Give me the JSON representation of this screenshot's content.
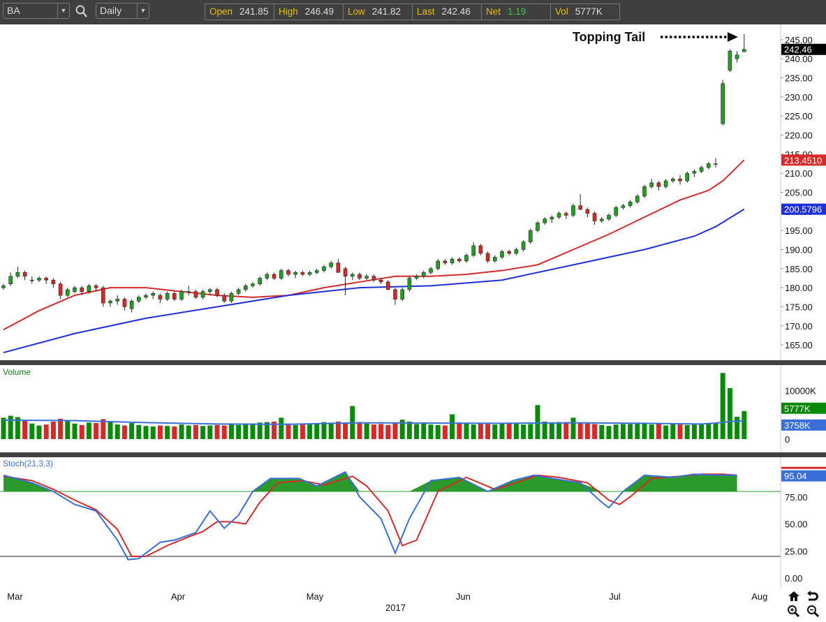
{
  "toolbar": {
    "symbol": "BA",
    "period": "Daily",
    "quote": [
      {
        "label": "Open",
        "value": "241.85"
      },
      {
        "label": "High",
        "value": "246.49"
      },
      {
        "label": "Low",
        "value": "241.82"
      },
      {
        "label": "Last",
        "value": "242.46"
      },
      {
        "label": "Net",
        "value": "1.19"
      },
      {
        "label": "Vol",
        "value": "5777K"
      }
    ]
  },
  "annotation": "Topping Tail",
  "price_tags": {
    "last": "242.46",
    "ma_fast": "213.4510",
    "ma_slow": "200.5796"
  },
  "volume": {
    "title": "Volume",
    "tag_vol": "5777K",
    "tag_ma": "3758K",
    "tick_10000": "10000K",
    "tick_0": "0"
  },
  "stoch": {
    "title": "Stoch(21,3,3)",
    "tag": "95.04"
  },
  "colors": {
    "up": "#22a022",
    "down": "#d42a2a",
    "ma_fast": "#d42a2a",
    "ma_slow": "#1f2fd8",
    "vol_ma": "#3a6fd8",
    "stoch_k": "#3a6fd8",
    "stoch_d": "#d42a2a",
    "fill": "#2a9a2a"
  },
  "chart_data": {
    "type": "candlestick",
    "title": "BA Daily",
    "ylim": [
      161,
      249
    ],
    "yticks": [
      "165.00",
      "170.00",
      "175.00",
      "180.00",
      "185.00",
      "190.00",
      "195.00",
      "200.00",
      "205.00",
      "210.00",
      "215.00",
      "220.00",
      "225.00",
      "230.00",
      "235.00",
      "240.00",
      "245.00"
    ],
    "xlabels": [
      {
        "label": "Mar",
        "i": 1.5
      },
      {
        "label": "Apr",
        "i": 24.5
      },
      {
        "label": "May",
        "i": 43.5
      },
      {
        "label": "Jun",
        "i": 64.5
      },
      {
        "label": "Jul",
        "i": 86
      },
      {
        "label": "Aug",
        "i": 106
      }
    ],
    "year_label": {
      "label": "2017",
      "i": 55
    },
    "candles": [
      [
        180,
        181,
        179.5,
        180.5
      ],
      [
        181,
        184,
        180.5,
        183
      ],
      [
        183,
        185.5,
        182.5,
        184
      ],
      [
        184,
        184.5,
        182,
        183
      ],
      [
        182,
        183,
        181,
        182
      ],
      [
        182,
        183,
        181.5,
        182.5
      ],
      [
        182.5,
        183,
        181,
        182
      ],
      [
        182,
        182.5,
        180,
        181
      ],
      [
        181,
        181.5,
        177,
        178
      ],
      [
        178,
        180,
        177.5,
        179.5
      ],
      [
        179,
        180.5,
        178.5,
        180
      ],
      [
        180,
        180.5,
        178,
        179
      ],
      [
        179,
        181,
        178.5,
        180.5
      ],
      [
        180.5,
        181,
        179,
        180
      ],
      [
        180,
        180.5,
        175,
        176
      ],
      [
        176,
        177,
        175,
        176.5
      ],
      [
        176.5,
        178,
        175.5,
        177
      ],
      [
        177,
        177.5,
        174,
        175
      ],
      [
        174.5,
        177,
        173.5,
        176.5
      ],
      [
        176.5,
        178,
        176,
        177.5
      ],
      [
        177.5,
        178.5,
        177,
        178
      ],
      [
        178,
        179,
        177,
        178.5
      ],
      [
        178,
        178.5,
        176,
        177
      ],
      [
        177,
        179,
        176.5,
        178.5
      ],
      [
        178.5,
        179,
        176.5,
        177
      ],
      [
        177,
        179.5,
        176.5,
        179
      ],
      [
        179,
        180.5,
        178,
        179
      ],
      [
        179,
        179.5,
        177,
        177.5
      ],
      [
        177.5,
        179.5,
        177,
        179
      ],
      [
        179,
        180,
        178,
        179.5
      ],
      [
        179.5,
        180,
        177.5,
        178
      ],
      [
        178,
        178.5,
        176,
        176.5
      ],
      [
        176.5,
        179,
        176,
        178.5
      ],
      [
        178.5,
        180,
        178,
        179.5
      ],
      [
        179.5,
        181,
        179,
        180.5
      ],
      [
        180.5,
        181.5,
        180,
        181
      ],
      [
        181,
        183,
        180.5,
        182.5
      ],
      [
        182.5,
        184,
        182,
        183.5
      ],
      [
        183.5,
        184,
        182,
        182.5
      ],
      [
        182.5,
        185,
        182,
        184.5
      ],
      [
        184.5,
        185,
        183,
        183.5
      ],
      [
        183.5,
        184.5,
        182.5,
        184
      ],
      [
        184,
        184.5,
        183,
        183.5
      ],
      [
        183.5,
        184.5,
        183,
        184
      ],
      [
        184,
        185,
        183.5,
        184.5
      ],
      [
        184.5,
        186,
        184,
        185.5
      ],
      [
        185.5,
        187,
        185,
        186.5
      ],
      [
        186.5,
        187.5,
        185.5,
        184
      ],
      [
        185,
        185.5,
        178,
        183
      ],
      [
        183,
        184,
        182,
        183.5
      ],
      [
        183.5,
        184,
        182,
        182.5
      ],
      [
        182.5,
        183.5,
        182,
        183
      ],
      [
        183,
        183.5,
        181.5,
        182
      ],
      [
        182,
        182.5,
        181,
        181.5
      ],
      [
        181.5,
        182,
        179.5,
        179.5
      ],
      [
        179.5,
        180,
        175.5,
        177
      ],
      [
        177,
        180,
        176.5,
        179.5
      ],
      [
        179.5,
        183,
        179,
        182.5
      ],
      [
        182.5,
        183.5,
        182,
        183
      ],
      [
        183,
        184.5,
        182.5,
        184
      ],
      [
        184,
        185.5,
        183.5,
        185
      ],
      [
        185,
        187.5,
        184.5,
        187
      ],
      [
        187,
        187.5,
        186,
        186.5
      ],
      [
        186.5,
        188,
        186,
        187.5
      ],
      [
        187.5,
        188,
        186.5,
        187
      ],
      [
        187,
        189,
        186.5,
        188.5
      ],
      [
        188.5,
        192,
        188,
        191
      ],
      [
        191,
        191.5,
        188.5,
        189
      ],
      [
        189,
        189.5,
        186.5,
        187
      ],
      [
        187,
        188.5,
        186.5,
        188
      ],
      [
        188,
        190,
        187.5,
        189.5
      ],
      [
        189.5,
        190,
        188.5,
        189
      ],
      [
        189,
        190.5,
        188.5,
        190
      ],
      [
        190,
        192.5,
        189.5,
        192
      ],
      [
        192,
        195.5,
        191.5,
        195
      ],
      [
        195,
        197.5,
        194.5,
        197
      ],
      [
        197,
        198.5,
        196.5,
        198
      ],
      [
        198,
        199,
        197,
        198.5
      ],
      [
        198.5,
        200,
        198,
        199.5
      ],
      [
        199.5,
        200,
        198,
        199
      ],
      [
        199,
        202,
        198.5,
        201.5
      ],
      [
        201.5,
        204.5,
        200.5,
        200.5
      ],
      [
        200.5,
        201,
        198.5,
        199.5
      ],
      [
        199.5,
        200,
        196.5,
        197.5
      ],
      [
        197.5,
        198.5,
        197,
        198
      ],
      [
        198,
        199.5,
        197.5,
        199
      ],
      [
        199,
        201.5,
        198.5,
        201
      ],
      [
        201,
        202,
        200.5,
        201.5
      ],
      [
        201.5,
        203,
        201,
        202.5
      ],
      [
        202.5,
        204.5,
        202,
        204
      ],
      [
        204,
        207,
        203.5,
        206.5
      ],
      [
        206.5,
        208.5,
        206,
        207.5
      ],
      [
        207.5,
        208,
        205.5,
        206.5
      ],
      [
        206.5,
        208.5,
        206,
        208
      ],
      [
        208,
        209,
        207.5,
        208.5
      ],
      [
        208.5,
        209.5,
        207,
        208
      ],
      [
        208,
        210.5,
        207.5,
        210
      ],
      [
        210,
        211,
        209,
        210.5
      ],
      [
        210.5,
        212,
        210,
        211.5
      ],
      [
        211.5,
        213,
        211,
        212.5
      ],
      [
        212.5,
        214,
        211.5,
        212.5
      ],
      [
        223,
        234.5,
        222.5,
        233.5
      ],
      [
        237,
        242.5,
        236.5,
        242
      ],
      [
        240,
        242,
        239,
        241
      ],
      [
        241.85,
        246.49,
        241.82,
        242.46
      ]
    ],
    "ma_fast": [
      [
        0,
        169
      ],
      [
        5,
        174
      ],
      [
        10,
        178
      ],
      [
        15,
        180
      ],
      [
        20,
        180
      ],
      [
        25,
        179
      ],
      [
        30,
        178
      ],
      [
        35,
        177.5
      ],
      [
        40,
        178
      ],
      [
        45,
        180
      ],
      [
        50,
        181.5
      ],
      [
        55,
        183
      ],
      [
        60,
        183
      ],
      [
        65,
        183.5
      ],
      [
        70,
        184.5
      ],
      [
        75,
        186
      ],
      [
        80,
        190
      ],
      [
        85,
        194
      ],
      [
        90,
        198.5
      ],
      [
        95,
        203
      ],
      [
        99,
        205.5
      ],
      [
        101,
        208
      ],
      [
        104,
        213.45
      ]
    ],
    "ma_slow": [
      [
        0,
        163
      ],
      [
        10,
        168
      ],
      [
        20,
        172
      ],
      [
        30,
        175
      ],
      [
        40,
        178
      ],
      [
        50,
        180
      ],
      [
        60,
        180.5
      ],
      [
        70,
        182
      ],
      [
        80,
        186
      ],
      [
        90,
        190
      ],
      [
        97,
        193.5
      ],
      [
        100,
        196
      ],
      [
        104,
        200.58
      ]
    ],
    "volume": [
      4400,
      4800,
      4500,
      3800,
      3200,
      2800,
      3000,
      3600,
      4200,
      3800,
      3200,
      2900,
      3400,
      3300,
      4100,
      3500,
      3000,
      2800,
      3300,
      2900,
      2700,
      2600,
      2800,
      2700,
      2600,
      3000,
      2800,
      2900,
      2700,
      2800,
      2900,
      2800,
      3100,
      2900,
      3000,
      3200,
      3400,
      3500,
      3600,
      4400,
      3200,
      2900,
      3000,
      3100,
      3300,
      3500,
      3400,
      3600,
      3300,
      6800,
      3500,
      3200,
      3000,
      3100,
      2900,
      3300,
      4000,
      3600,
      3100,
      3200,
      3000,
      2900,
      2800,
      5100,
      3400,
      3200,
      3000,
      3200,
      3100,
      3000,
      3300,
      3200,
      3300,
      3000,
      3100,
      7000,
      3600,
      3400,
      3500,
      3500,
      4400,
      3400,
      3200,
      3100,
      2900,
      2700,
      3000,
      3100,
      3100,
      3300,
      3200,
      3000,
      3300,
      2800,
      3100,
      3000,
      2900,
      3000,
      3100,
      3200,
      3300,
      13600,
      10500,
      4600,
      5777
    ],
    "volume_ma": [
      [
        0,
        3900
      ],
      [
        10,
        3800
      ],
      [
        20,
        3400
      ],
      [
        30,
        3100
      ],
      [
        40,
        3050
      ],
      [
        50,
        3350
      ],
      [
        60,
        3300
      ],
      [
        70,
        3250
      ],
      [
        80,
        3350
      ],
      [
        90,
        3250
      ],
      [
        98,
        3100
      ],
      [
        100,
        3300
      ],
      [
        102,
        3600
      ],
      [
        104,
        3758
      ]
    ],
    "volume_ylim": [
      0,
      14500
    ],
    "stoch_ticks": [
      "0.00",
      "25.00",
      "50.00",
      "75.00"
    ],
    "stoch_levels": [
      80,
      20
    ],
    "stoch_k": [
      [
        0,
        95
      ],
      [
        4,
        88
      ],
      [
        7,
        80
      ],
      [
        10,
        68
      ],
      [
        13,
        62
      ],
      [
        16,
        35
      ],
      [
        17.5,
        17
      ],
      [
        19,
        18
      ],
      [
        22,
        33
      ],
      [
        24,
        35
      ],
      [
        27,
        42
      ],
      [
        29,
        62
      ],
      [
        31,
        46
      ],
      [
        33,
        58
      ],
      [
        35,
        80
      ],
      [
        37.5,
        92
      ],
      [
        41.5,
        92
      ],
      [
        44,
        85
      ],
      [
        48,
        98
      ],
      [
        50,
        75
      ],
      [
        53,
        55
      ],
      [
        55,
        23
      ],
      [
        57,
        55
      ],
      [
        60,
        90
      ],
      [
        64,
        93
      ],
      [
        68,
        80
      ],
      [
        71.5,
        90
      ],
      [
        74.5,
        95
      ],
      [
        77,
        92
      ],
      [
        81,
        88
      ],
      [
        84,
        70
      ],
      [
        85,
        65
      ],
      [
        87,
        80
      ],
      [
        90,
        95
      ],
      [
        94,
        93
      ],
      [
        97,
        96
      ],
      [
        100,
        95
      ],
      [
        103,
        95
      ]
    ],
    "stoch_d": [
      [
        0,
        94
      ],
      [
        4,
        90
      ],
      [
        7,
        82
      ],
      [
        10,
        72
      ],
      [
        13,
        63
      ],
      [
        16,
        45
      ],
      [
        18,
        20
      ],
      [
        20,
        20
      ],
      [
        23,
        30
      ],
      [
        26,
        38
      ],
      [
        28,
        43
      ],
      [
        30,
        52
      ],
      [
        32,
        52
      ],
      [
        34,
        50
      ],
      [
        36,
        70
      ],
      [
        38.5,
        88
      ],
      [
        42,
        90
      ],
      [
        45,
        86
      ],
      [
        49,
        94
      ],
      [
        51,
        85
      ],
      [
        54,
        62
      ],
      [
        56,
        30
      ],
      [
        58,
        35
      ],
      [
        61,
        80
      ],
      [
        65,
        93
      ],
      [
        69,
        82
      ],
      [
        72,
        88
      ],
      [
        75,
        95
      ],
      [
        78,
        93
      ],
      [
        82,
        88
      ],
      [
        85,
        72
      ],
      [
        86.5,
        68
      ],
      [
        88,
        75
      ],
      [
        91,
        92
      ],
      [
        95,
        94
      ],
      [
        98,
        96
      ],
      [
        101,
        96
      ],
      [
        103,
        95.04
      ]
    ]
  }
}
